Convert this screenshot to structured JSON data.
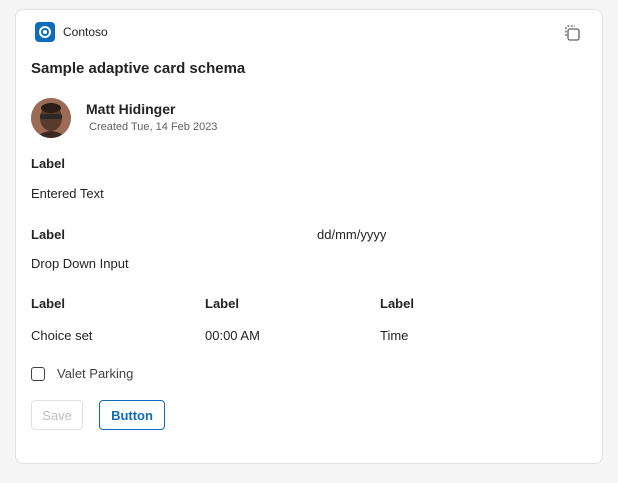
{
  "app": {
    "name": "Contoso",
    "icon": "contoso-logo-icon",
    "accent": "#0f6cbd"
  },
  "card": {
    "title": "Sample adaptive card schema",
    "copy_icon": "copy-icon",
    "author": {
      "name": "Matt Hidinger",
      "created": "Created Tue, 14 Feb 2023"
    },
    "text_field": {
      "label": "Label",
      "value": "Entered Text"
    },
    "dropdown_row": {
      "label": "Label",
      "date_placeholder": "dd/mm/yyyy",
      "dropdown_value": "Drop Down Input"
    },
    "three_col": {
      "labels": [
        "Label",
        "Label",
        "Label"
      ],
      "values": [
        "Choice set",
        "00:00 AM",
        "Time"
      ]
    },
    "checkbox": {
      "label": "Valet Parking",
      "checked": false
    },
    "buttons": {
      "save": "Save",
      "primary": "Button"
    }
  }
}
